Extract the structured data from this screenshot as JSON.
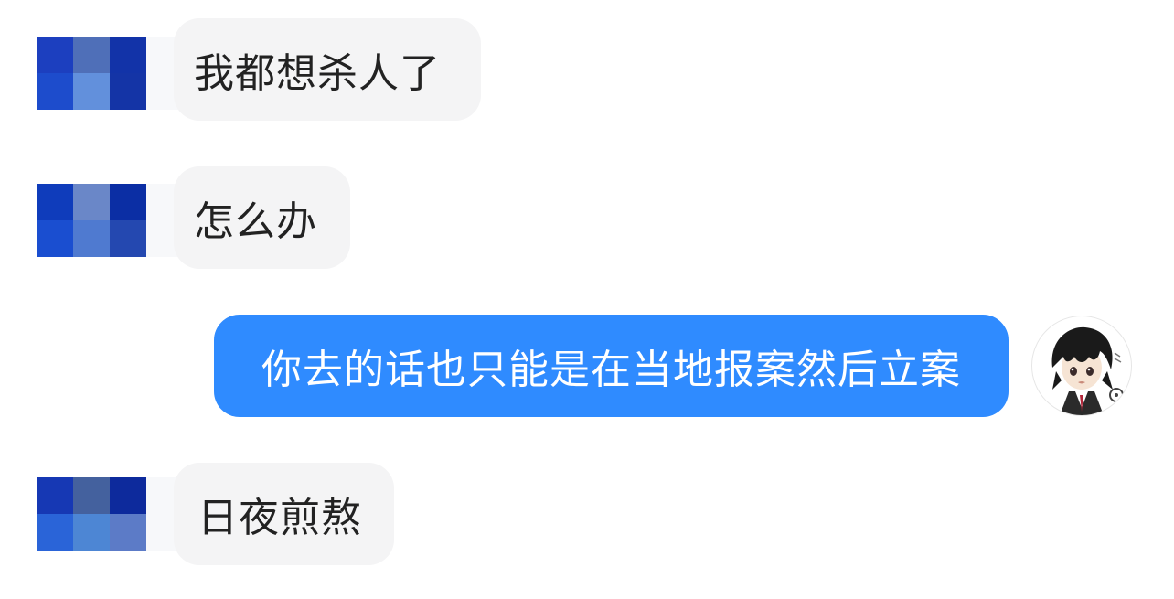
{
  "messages": [
    {
      "from": "them",
      "text": "我都想杀人了",
      "avatar_colors": [
        "#1c3fbf",
        "#4f6fb8",
        "#1233a8",
        "#1d4ccc",
        "#6290dc",
        "#1434a6"
      ]
    },
    {
      "from": "them",
      "text": "怎么办",
      "avatar_colors": [
        "#0f3cbb",
        "#6a87c8",
        "#0b2ea4",
        "#1a4ed0",
        "#4f7ad0",
        "#2448b0"
      ]
    },
    {
      "from": "me",
      "text": "你去的话也只能是在当地报案然后立案",
      "avatar_icon": "anime-boy-avatar-icon"
    },
    {
      "from": "them",
      "text": "日夜煎熬",
      "avatar_colors": [
        "#1638b4",
        "#44619e",
        "#0d2a9c",
        "#2a64d8",
        "#4d86d4",
        "#5c7bc7"
      ]
    }
  ],
  "colors": {
    "outgoing_bubble": "#2f8bff",
    "incoming_bubble": "#f4f4f5",
    "incoming_text": "#222222",
    "outgoing_text": "#ffffff"
  }
}
